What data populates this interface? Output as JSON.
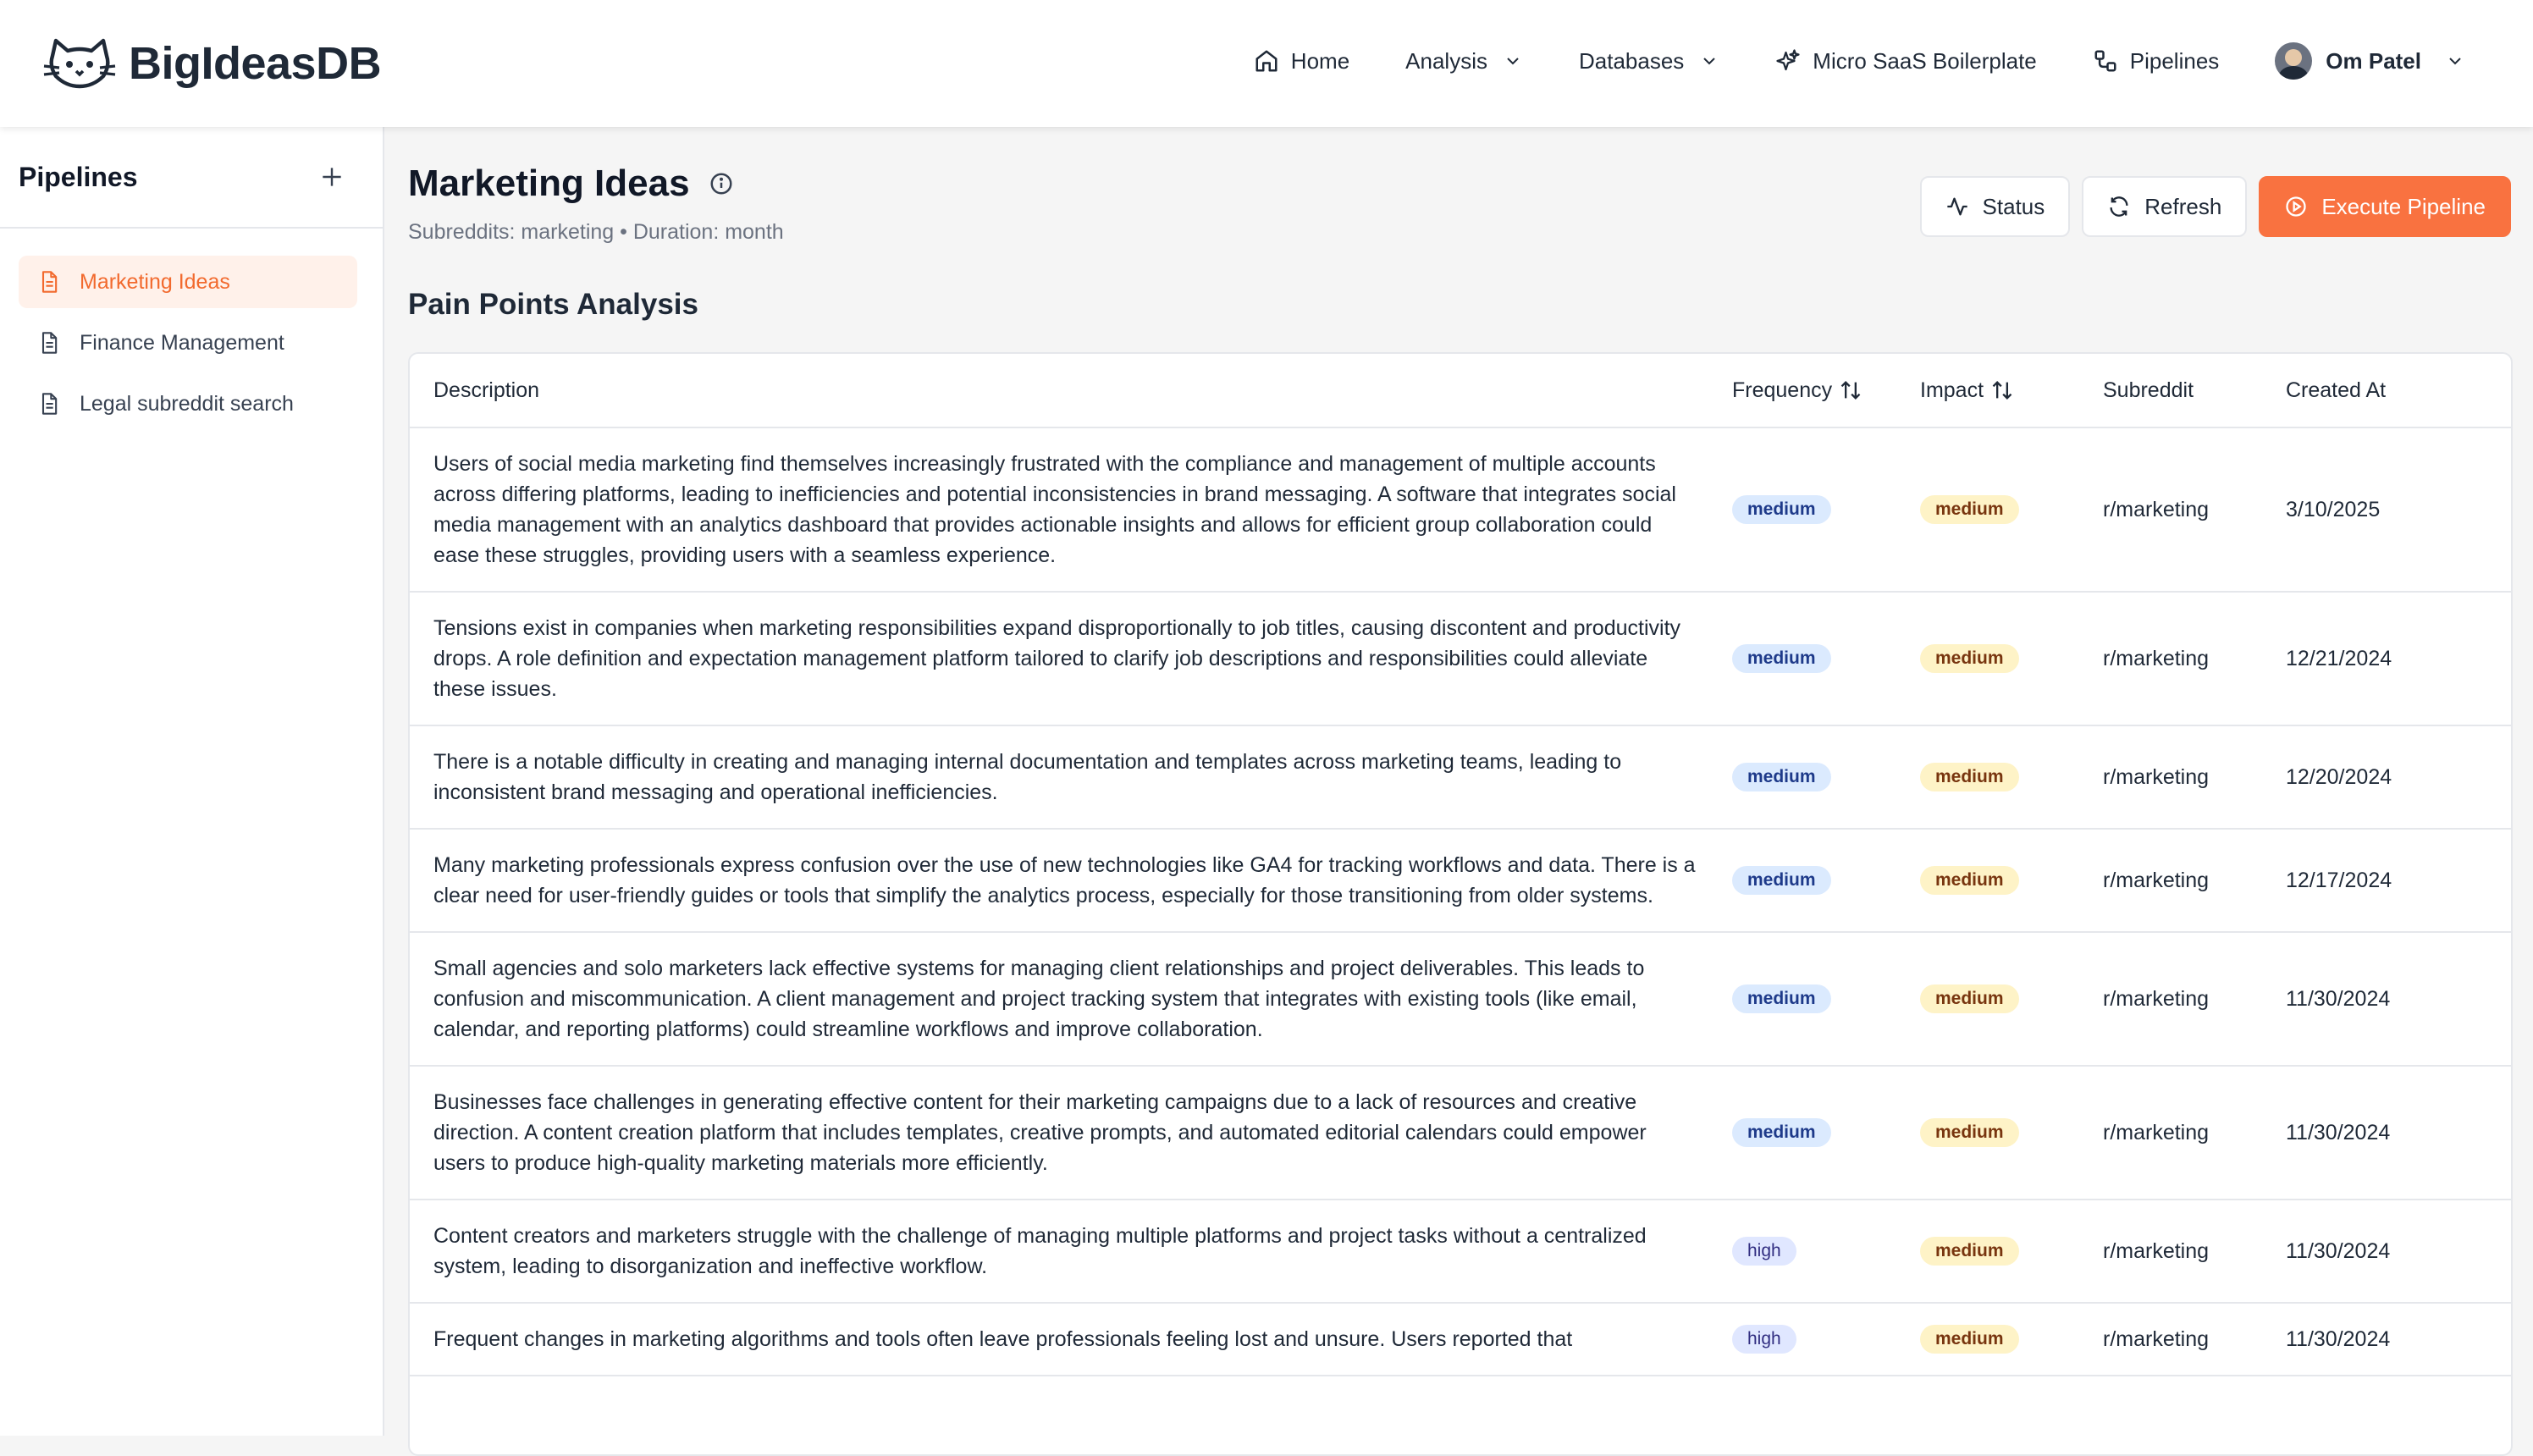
{
  "brand": {
    "name": "BigIdeasDB"
  },
  "nav": {
    "home": "Home",
    "analysis": "Analysis",
    "databases": "Databases",
    "boilerplate": "Micro SaaS Boilerplate",
    "pipelines": "Pipelines",
    "user": "Om Patel"
  },
  "sidebar": {
    "title": "Pipelines",
    "items": [
      {
        "label": "Marketing Ideas"
      },
      {
        "label": "Finance Management"
      },
      {
        "label": "Legal subreddit search"
      }
    ]
  },
  "page": {
    "title": "Marketing Ideas",
    "subtitle": "Subreddits: marketing • Duration: month",
    "section": "Pain Points Analysis",
    "buttons": {
      "status": "Status",
      "refresh": "Refresh",
      "execute": "Execute Pipeline"
    }
  },
  "table": {
    "headers": {
      "description": "Description",
      "frequency": "Frequency",
      "impact": "Impact",
      "subreddit": "Subreddit",
      "created": "Created At"
    },
    "rows": [
      {
        "description": "Users of social media marketing find themselves increasingly frustrated with the compliance and management of multiple accounts across differing platforms, leading to inefficiencies and potential inconsistencies in brand messaging. A software that integrates social media management with an analytics dashboard that provides actionable insights and allows for efficient group collaboration could ease these struggles, providing users with a seamless experience.",
        "frequency": "medium",
        "impact": "medium",
        "subreddit": "r/marketing",
        "created": "3/10/2025"
      },
      {
        "description": "Tensions exist in companies when marketing responsibilities expand disproportionally to job titles, causing discontent and productivity drops. A role definition and expectation management platform tailored to clarify job descriptions and responsibilities could alleviate these issues.",
        "frequency": "medium",
        "impact": "medium",
        "subreddit": "r/marketing",
        "created": "12/21/2024"
      },
      {
        "description": "There is a notable difficulty in creating and managing internal documentation and templates across marketing teams, leading to inconsistent brand messaging and operational inefficiencies.",
        "frequency": "medium",
        "impact": "medium",
        "subreddit": "r/marketing",
        "created": "12/20/2024"
      },
      {
        "description": "Many marketing professionals express confusion over the use of new technologies like GA4 for tracking workflows and data. There is a clear need for user-friendly guides or tools that simplify the analytics process, especially for those transitioning from older systems.",
        "frequency": "medium",
        "impact": "medium",
        "subreddit": "r/marketing",
        "created": "12/17/2024"
      },
      {
        "description": "Small agencies and solo marketers lack effective systems for managing client relationships and project deliverables. This leads to confusion and miscommunication. A client management and project tracking system that integrates with existing tools (like email, calendar, and reporting platforms) could streamline workflows and improve collaboration.",
        "frequency": "medium",
        "impact": "medium",
        "subreddit": "r/marketing",
        "created": "11/30/2024"
      },
      {
        "description": "Businesses face challenges in generating effective content for their marketing campaigns due to a lack of resources and creative direction. A content creation platform that includes templates, creative prompts, and automated editorial calendars could empower users to produce high-quality marketing materials more efficiently.",
        "frequency": "medium",
        "impact": "medium",
        "subreddit": "r/marketing",
        "created": "11/30/2024"
      },
      {
        "description": "Content creators and marketers struggle with the challenge of managing multiple platforms and project tasks without a centralized system, leading to disorganization and ineffective workflow.",
        "frequency": "high",
        "impact": "medium",
        "subreddit": "r/marketing",
        "created": "11/30/2024"
      },
      {
        "description": "Frequent changes in marketing algorithms and tools often leave professionals feeling lost and unsure. Users reported that",
        "frequency": "high",
        "impact": "medium",
        "subreddit": "r/marketing",
        "created": "11/30/2024"
      }
    ]
  }
}
